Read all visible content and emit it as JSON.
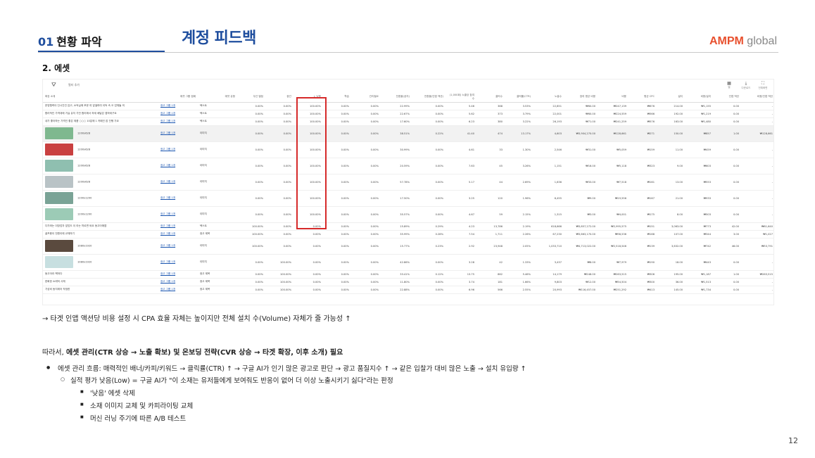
{
  "header": {
    "section_number": "01",
    "section_label": "현황 파악",
    "main_title": "계정 피드백",
    "logo_primary": "AMPM",
    "logo_secondary": "global"
  },
  "subsection_title": "2. 에셋",
  "table": {
    "toolbar": {
      "filter_label": "필터 추가",
      "icons": [
        {
          "name": "table-icon",
          "glyph": "▦",
          "label": "열"
        },
        {
          "name": "download-icon",
          "glyph": "⤓",
          "label": "다운로드"
        },
        {
          "name": "expand-icon",
          "glyph": "⛶",
          "label": "전체화면"
        }
      ]
    },
    "group_header": "실적 평가",
    "red_box_color": "#d62a2a",
    "columns": [
      "확장 소재",
      "애셋 그룹 캠페",
      "애셋 유형",
      "우선 별점",
      "중간",
      "↓ 낮음",
      "학습",
      "관리필요",
      "전환율(공지)",
      "전환율(인앱 액션)",
      "(1,000회) 노출당 참여 수",
      "클릭수",
      "클릭률(CTR)",
      "노출수",
      "참여 평균 비용",
      "비용",
      "평균 CPC",
      "설치",
      "비용/설치",
      "인앱 액션",
      "비용/인앱 액션"
    ],
    "rows": [
      {
        "kind": "txt",
        "grey": false,
        "thumb": "",
        "cells": [
          "운영협력이 단시간진 않고, 소득실에 포문 여 앞셀하여 이득 속 오 업체들 의",
          "광고 그룹 1개",
          "텍스트",
          "0.00%",
          "0.00%",
          "100.00%",
          "0.00%",
          "0.00%",
          "22.99%",
          "0.00%",
          "5.46",
          "368",
          "3.53%",
          "22,851",
          "₩60.00",
          "₩247,139",
          "₩676",
          "214.00",
          "₩1,155",
          "0.00",
          "-"
        ]
      },
      {
        "kind": "txt",
        "grey": false,
        "thumb": "",
        "cells": [
          "합리적인 가격대에 거실 유지 가전 합리에서 하세 배달은 앱하세구요",
          "광고 그룹 1개",
          "텍스트",
          "0.00%",
          "0.00%",
          "100.00%",
          "0.00%",
          "0.00%",
          "22.67%",
          "0.00%",
          "5.62",
          "373",
          "3.79%",
          "22,001",
          "₩60.00",
          "₩224,559",
          "₩566",
          "192.00",
          "₩1,219",
          "0.00",
          "-"
        ]
      },
      {
        "kind": "txt",
        "grey": false,
        "thumb": "",
        "cells": [
          "내가 좋아하는 가격인 좋은 제품 ○○○ 10분에 1 카페인 잡 진행 가요",
          "광고 그룹 1개",
          "텍스트",
          "0.00%",
          "0.00%",
          "100.00%",
          "0.00%",
          "0.00%",
          "17.60%",
          "0.00%",
          "6.23",
          "380",
          "3.22%",
          "26,193",
          "₩71.00",
          "₩241,259",
          "₩576",
          "163.00",
          "₩1,480",
          "0.00",
          "-"
        ]
      },
      {
        "kind": "img",
        "grey": true,
        "thumb": "#7fb88f",
        "cells": [
          "1200x628",
          "광고 그룹 1개",
          "이미지",
          "0.00%",
          "0.00%",
          "100.00%",
          "0.00%",
          "0.00%",
          "38.51%",
          "0.22%",
          "41.40",
          "474",
          "13.17%",
          "4,603",
          "₩3,904,270.00",
          "₩128,661",
          "₩271",
          "150.00",
          "₩857",
          "1.00",
          "₩128,661"
        ]
      },
      {
        "kind": "img",
        "grey": false,
        "thumb": "#c94040",
        "cells": [
          "1200x628",
          "광고 그룹 1개",
          "이미지",
          "0.00%",
          "0.00%",
          "100.00%",
          "0.00%",
          "0.00%",
          "30.99%",
          "0.00%",
          "4.61",
          "33",
          "1.30%",
          "2,546",
          "₩31.00",
          "₩5,059",
          "₩159",
          "11.00",
          "₩459",
          "0.00",
          "-"
        ]
      },
      {
        "kind": "img",
        "grey": false,
        "thumb": "#8fbfb0",
        "cells": [
          "1200x628",
          "광고 그룹 1개",
          "이미지",
          "0.00%",
          "0.00%",
          "100.00%",
          "0.00%",
          "0.00%",
          "20.59%",
          "0.00%",
          "7.63",
          "45",
          "3.26%",
          "1,151",
          "₩16.00",
          "₩5,118",
          "₩323",
          "9.00",
          "₩603",
          "0.00",
          "-"
        ]
      },
      {
        "kind": "img",
        "grey": false,
        "thumb": "#b9c3c6",
        "cells": [
          "1200x628",
          "광고 그룹 1개",
          "이미지",
          "0.00%",
          "0.00%",
          "100.00%",
          "0.00%",
          "0.00%",
          "57.78%",
          "0.00%",
          "5.17",
          "44",
          "2.69%",
          "1,636",
          "₩33.00",
          "₩7,518",
          "₩161",
          "13.00",
          "₩553",
          "0.00",
          "-"
        ]
      },
      {
        "kind": "img",
        "grey": false,
        "thumb": "#7aa396",
        "cells": [
          "1200x1200",
          "광고 그룹 1개",
          "이미지",
          "0.00%",
          "0.00%",
          "100.00%",
          "0.00%",
          "0.00%",
          "17.50%",
          "0.00%",
          "3.25",
          "120",
          "1.96%",
          "6,455",
          "₩9.00",
          "₩19,556",
          "₩167",
          "21.00",
          "₩933",
          "0.00",
          "-"
        ]
      },
      {
        "kind": "img",
        "grey": false,
        "thumb": "#9ccbb6",
        "cells": [
          "1200x1200",
          "광고 그룹 1개",
          "이미지",
          "0.00%",
          "0.00%",
          "100.00%",
          "0.00%",
          "0.00%",
          "35.57%",
          "0.00%",
          "4.67",
          "59",
          "2.15%",
          "1,315",
          "₩3.00",
          "₩4,001",
          "₩175",
          "8.00",
          "₩503",
          "0.00",
          "-"
        ]
      },
      {
        "kind": "txt",
        "grey": false,
        "thumb": "",
        "cells": [
          "다가와는 이창업자 앞업도 이 라는 따르면 써요 동고어에앱",
          "광고 그룹 1개",
          "텍스트",
          "100.00%",
          "0.00%",
          "0.00%",
          "0.00%",
          "0.00%",
          "15.89%",
          "0.29%",
          "4.23",
          "13,786",
          "2.19%",
          "618,666",
          "₩3,857,272.00",
          "₩2,995,575",
          "₩151",
          "3,063.00",
          "₩773",
          "42.00",
          "₩61,640"
        ]
      },
      {
        "kind": "txt",
        "grey": false,
        "thumb": "",
        "cells": [
          "골프용이 전원이에 교체하기",
          "광고 그룹 1개",
          "광고 제목",
          "100.00%",
          "0.00%",
          "0.00%",
          "0.00%",
          "0.00%",
          "35.99%",
          "0.28%",
          "7.54",
          "1,711",
          "2.26%",
          "67,230",
          "₩3,663,170.00",
          "₩98,536",
          "₩168",
          "107.00",
          "₩344",
          "3.00",
          "₩1,027"
        ]
      },
      {
        "kind": "img",
        "grey": false,
        "thumb": "#5a4a3e",
        "cells": [
          "1080x1920",
          "광고 그룹 1개",
          "이미지",
          "100.00%",
          "0.00%",
          "0.00%",
          "0.00%",
          "0.00%",
          "15.77%",
          "0.23%",
          "2.92",
          "23,948",
          "2.05%",
          "1,033,710",
          "₩4,713,022.00",
          "₩2,518,546",
          "₩139",
          "3,632.00",
          "₩742",
          "46.00",
          "₩53,791"
        ]
      },
      {
        "kind": "img",
        "grey": false,
        "thumb": "#c7dfe0",
        "cells": [
          "1080x1920",
          "광고 그룹 1개",
          "이미지",
          "0.00%",
          "100.00%",
          "0.00%",
          "0.00%",
          "0.00%",
          "42.86%",
          "0.00%",
          "3.28",
          "42",
          "1.33%",
          "3,437",
          "₩8.00",
          "₩7,979",
          "₩190",
          "18.00",
          "₩443",
          "0.00",
          "-"
        ]
      },
      {
        "kind": "txt",
        "grey": false,
        "thumb": "",
        "cells": [
          "동고어라 책하다",
          "광고 그룹 1개",
          "광고 제목",
          "0.00%",
          "100.00%",
          "0.00%",
          "0.00%",
          "0.00%",
          "33.41%",
          "0.12%",
          "13.75",
          "862",
          "5.46%",
          "14,179",
          "₩248.00",
          "₩263,515",
          "₩306",
          "195.00",
          "₩1,187",
          "1.00",
          "₩263,515"
        ]
      },
      {
        "kind": "txt",
        "grey": false,
        "thumb": "",
        "cells": [
          "한화한 소래덕 사체",
          "광고 그룹 1개",
          "광고 제목",
          "0.00%",
          "100.00%",
          "0.00%",
          "0.00%",
          "0.00%",
          "11.80%",
          "0.00%",
          "3.74",
          "181",
          "1.66%",
          "9,803",
          "₩12.00",
          "₩54,504",
          "₩300",
          "36.00",
          "₩1,513",
          "0.00",
          "-"
        ]
      },
      {
        "kind": "txt",
        "grey": false,
        "thumb": "",
        "cells": [
          "가성비 동지에어 작정한",
          "광고 그룹 1개",
          "광고 제목",
          "0.00%",
          "100.00%",
          "0.00%",
          "0.00%",
          "0.00%",
          "22.88%",
          "0.00%",
          "6.96",
          "566",
          "2.55%",
          "20,993",
          "₩116,457.00",
          "₩251,292",
          "₩413",
          "145.00",
          "₩1,734",
          "0.00",
          "-"
        ]
      }
    ]
  },
  "note": "→ 타겟 인앱 액션당 비용 설정 시 CPA 효율 자체는 높이지만 전체 설치 수(Volume) 자체가 줄 가능성 ↑",
  "conclusion": {
    "prefix": "따라서, ",
    "bold": "에셋 관리(CTR 상승 → 노출 확보) 및 온보딩 전략(CVR 상승 → 타겟 확장, 이후 소개) 필요"
  },
  "bullets": {
    "level1": "에셋 관리 흐름: 매력적인 배너/카피/키워드 → 클릭률(CTR) ↑ → 구글 AI가 인기 많은 광고로 판단 → 광고 품질지수 ↑ → 같은 입찰가 대비 많은 노출 → 설치 유입량 ↑",
    "level2": "실적 평가 낮음(Low) = 구글 AI가 \"이 소재는 유저들에게 보여줘도 반응이 없어 더 이상 노출시키기 싫다\"라는 판정",
    "level3": [
      "'낮음' 에셋 삭제",
      "소재 이미지 교체 및 카피라이팅 교체",
      "머신 러닝 주기에 따른 A/B 테스트"
    ]
  },
  "page_number": "12"
}
